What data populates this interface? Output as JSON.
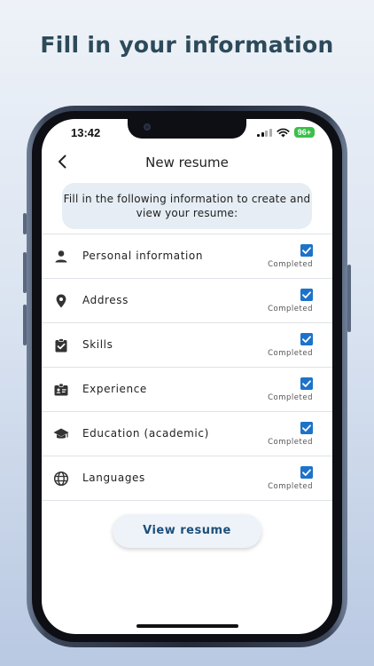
{
  "headline": "Fill in your information",
  "status_bar": {
    "time": "13:42",
    "battery": "96+"
  },
  "nav": {
    "title": "New resume"
  },
  "info_text": "Fill in the following information to create and view your resume:",
  "sections": [
    {
      "label": "Personal information",
      "status": "Completed",
      "icon": "person-icon",
      "checked": true
    },
    {
      "label": "Address",
      "status": "Completed",
      "icon": "location-pin-icon",
      "checked": true
    },
    {
      "label": "Skills",
      "status": "Completed",
      "icon": "clipboard-check-icon",
      "checked": true
    },
    {
      "label": "Experience",
      "status": "Completed",
      "icon": "badge-icon",
      "checked": true
    },
    {
      "label": "Education (academic)",
      "status": "Completed",
      "icon": "graduation-cap-icon",
      "checked": true
    },
    {
      "label": "Languages",
      "status": "Completed",
      "icon": "globe-icon",
      "checked": true
    }
  ],
  "view_button": {
    "label": "View resume"
  },
  "colors": {
    "accent": "#1d73c9",
    "button_text": "#1d4f7a",
    "headline": "#2c4a5a"
  }
}
